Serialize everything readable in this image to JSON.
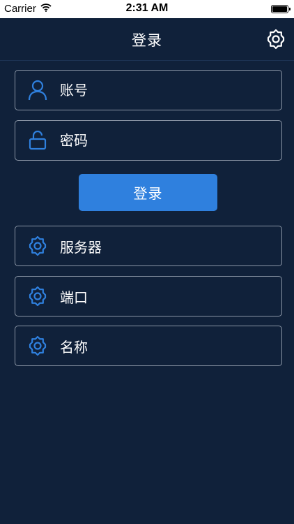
{
  "status_bar": {
    "carrier": "Carrier",
    "time": "2:31 AM",
    "battery_level": 1.0
  },
  "nav": {
    "title": "登录",
    "settings_icon": "gear-icon"
  },
  "form": {
    "account": {
      "placeholder": "账号",
      "icon": "user-icon"
    },
    "password": {
      "placeholder": "密码",
      "icon": "lock-icon"
    },
    "login_label": "登录"
  },
  "settings": {
    "items": [
      {
        "label": "服务器",
        "icon": "gear-icon"
      },
      {
        "label": "端口",
        "icon": "gear-icon"
      },
      {
        "label": "名称",
        "icon": "gear-icon"
      }
    ]
  },
  "colors": {
    "background": "#10213a",
    "accent": "#2f80de",
    "border": "#8a95a5"
  }
}
